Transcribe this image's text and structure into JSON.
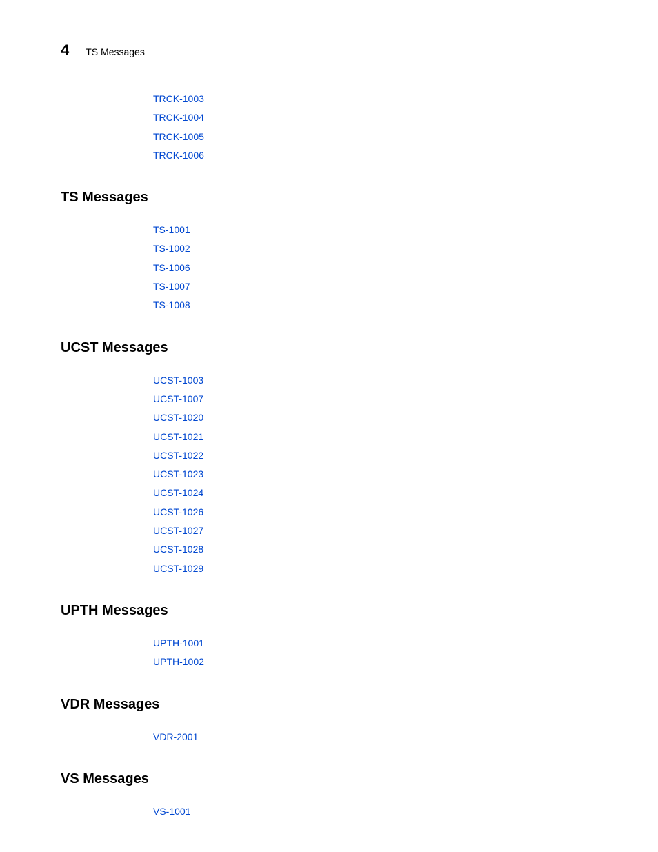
{
  "header": {
    "number": "4",
    "title": "TS Messages"
  },
  "sections": [
    {
      "heading": null,
      "links": [
        "TRCK-1003",
        "TRCK-1004",
        "TRCK-1005",
        "TRCK-1006"
      ]
    },
    {
      "heading": "TS Messages",
      "links": [
        "TS-1001",
        "TS-1002",
        "TS-1006",
        "TS-1007",
        "TS-1008"
      ]
    },
    {
      "heading": "UCST Messages",
      "links": [
        "UCST-1003",
        "UCST-1007",
        "UCST-1020",
        "UCST-1021",
        "UCST-1022",
        "UCST-1023",
        "UCST-1024",
        "UCST-1026",
        "UCST-1027",
        "UCST-1028",
        "UCST-1029"
      ]
    },
    {
      "heading": "UPTH Messages",
      "links": [
        "UPTH-1001",
        "UPTH-1002"
      ]
    },
    {
      "heading": "VDR Messages",
      "links": [
        "VDR-2001"
      ]
    },
    {
      "heading": "VS Messages",
      "links": [
        "VS-1001"
      ]
    }
  ]
}
